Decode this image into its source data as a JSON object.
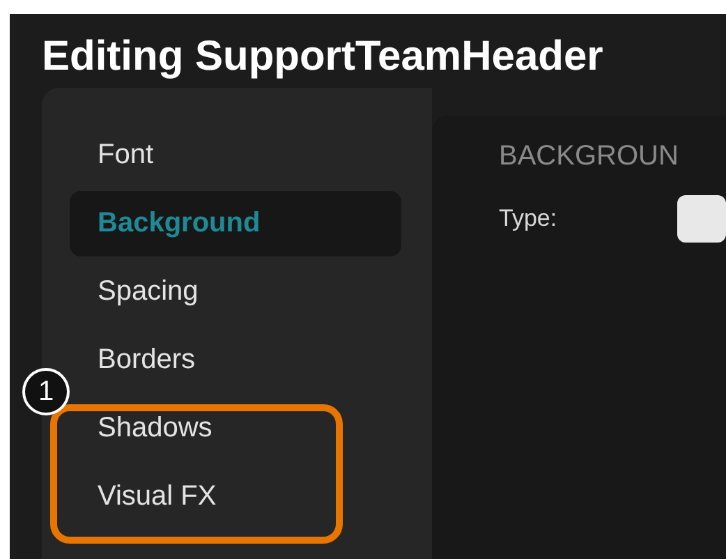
{
  "window": {
    "title": "Editing SupportTeamHeader"
  },
  "sidebar": {
    "items": [
      {
        "label": "Font",
        "selected": false
      },
      {
        "label": "Background",
        "selected": true
      },
      {
        "label": "Spacing",
        "selected": false
      },
      {
        "label": "Borders",
        "selected": false
      },
      {
        "label": "Shadows",
        "selected": false
      },
      {
        "label": "Visual FX",
        "selected": false
      }
    ]
  },
  "panel": {
    "heading": "BACKGROUN",
    "fields": [
      {
        "label": "Type:"
      }
    ]
  },
  "annotation": {
    "number": "1"
  }
}
